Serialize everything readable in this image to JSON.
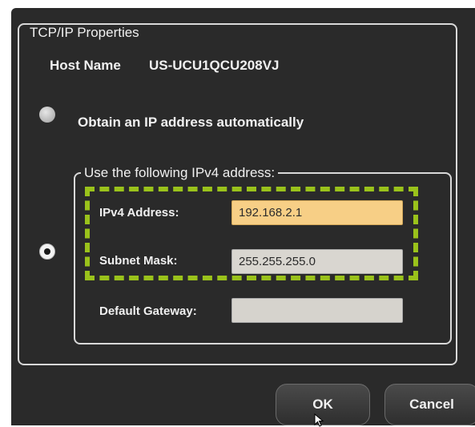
{
  "tcp_group": {
    "title": "TCP/IP Properties",
    "host_name_label": "Host Name",
    "host_name_value": "US-UCU1QCU208VJ"
  },
  "auto_option": {
    "label": "Obtain an IP address automatically",
    "selected": false
  },
  "manual_option": {
    "label": "Use the following IPv4 address:",
    "selected": true,
    "ipv4_address_label": "IPv4 Address:",
    "ipv4_address_value": "192.168.2.1",
    "subnet_mask_label": "Subnet Mask:",
    "subnet_mask_value": "255.255.255.0",
    "default_gateway_label": "Default Gateway:",
    "default_gateway_value": ""
  },
  "buttons": {
    "ok": "OK",
    "cancel": "Cancel"
  },
  "colors": {
    "highlight": "#9ac21b",
    "active_field": "#f7cf86",
    "dialog_bg": "#2a2a2a"
  },
  "icons": {
    "cursor": "mouse-pointer-icon"
  }
}
